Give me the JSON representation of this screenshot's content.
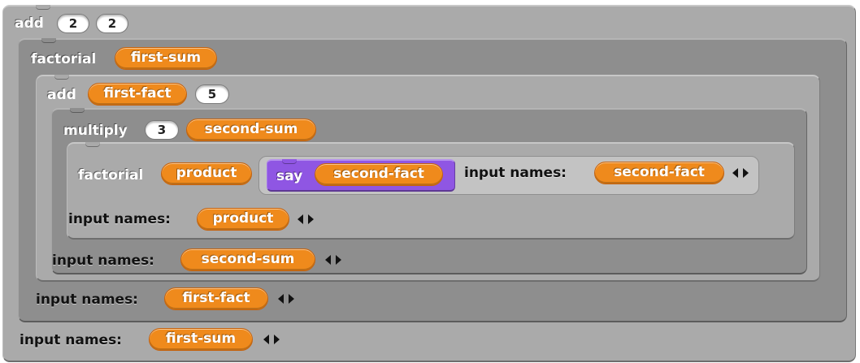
{
  "blocks": {
    "add_outer": {
      "label": "add",
      "inputs": [
        "2",
        "2"
      ]
    },
    "factorial_1": {
      "label": "factorial",
      "arg": "first-sum"
    },
    "add_inner": {
      "label": "add",
      "arg": "first-fact",
      "input": "5"
    },
    "multiply": {
      "label": "multiply",
      "input": "3",
      "arg": "second-sum"
    },
    "factorial_2": {
      "label": "factorial",
      "arg": "product"
    },
    "say": {
      "label": "say",
      "arg": "second-fact"
    }
  },
  "input_names_label": "input names:",
  "input_names_rows": [
    {
      "var": "second-fact"
    },
    {
      "var": "product"
    },
    {
      "var": "second-sum"
    },
    {
      "var": "first-fact"
    },
    {
      "var": "first-sum"
    }
  ],
  "icons": {
    "arrows": "left-right-arrows-icon"
  },
  "colors": {
    "operator_gray_dark": "#8e8e8e",
    "operator_gray_light": "#aaaaaa",
    "variable_orange": "#ef8a1c",
    "looks_purple": "#8f56e3"
  }
}
